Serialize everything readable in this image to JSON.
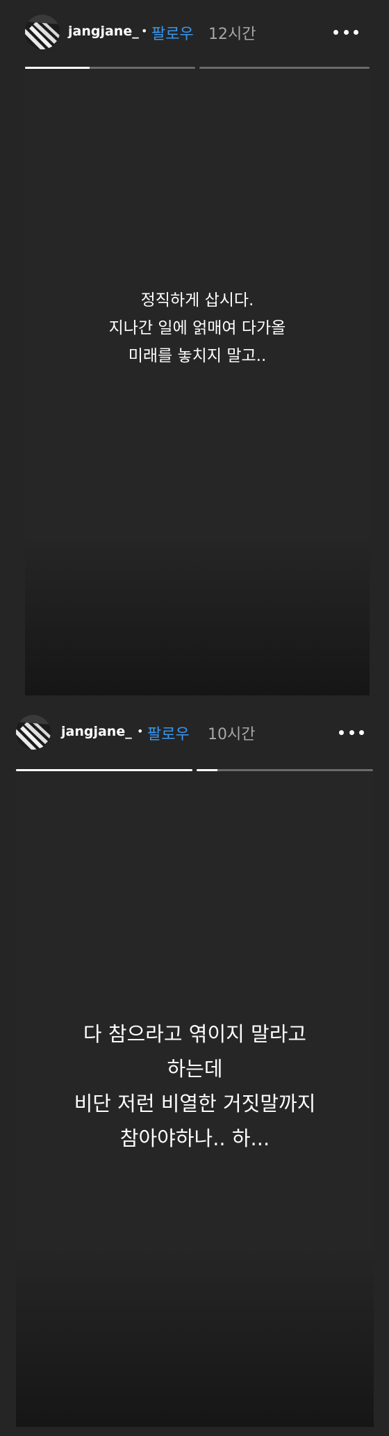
{
  "stories": [
    {
      "username": "jangjane_",
      "separator": "•",
      "follow_label": "팔로우",
      "time_ago": "12시간",
      "more_icon": "more-horizontal-icon",
      "progress": [
        0.38,
        0
      ],
      "caption": [
        "정직하게 삽시다.",
        "지나간 일에 얽매여 다가올",
        "미래를 놓치지 말고.."
      ]
    },
    {
      "username": "jangjane_",
      "separator": "•",
      "follow_label": "팔로우",
      "time_ago": "10시간",
      "more_icon": "more-horizontal-icon",
      "progress": [
        1,
        0.12
      ],
      "caption": [
        "다 참으라고 엮이지 말라고",
        "하는데",
        "비단 저런 비열한 거짓말까지",
        "참아야하나.. 하..."
      ]
    }
  ],
  "colors": {
    "background": "#252525",
    "follow": "#3897f0",
    "time": "#a8a8a8",
    "progress_track": "#6b6b6b",
    "progress_fill": "#ffffff"
  }
}
